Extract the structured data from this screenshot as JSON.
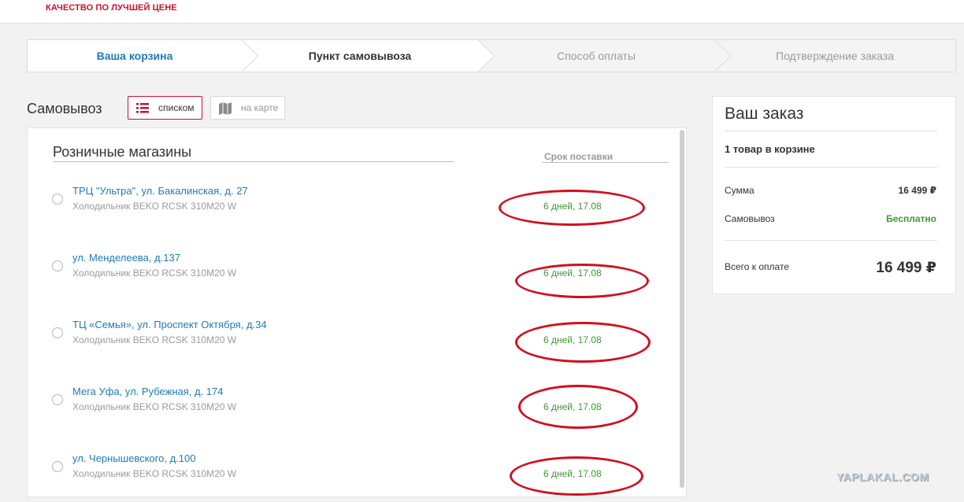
{
  "header": {
    "tagline": "КАЧЕСТВО ПО ЛУЧШЕЙ ЦЕНЕ"
  },
  "steps": [
    {
      "label": "Ваша корзина",
      "state": "completed"
    },
    {
      "label": "Пункт самовывоза",
      "state": "current"
    },
    {
      "label": "Способ оплаты",
      "state": "upcoming"
    },
    {
      "label": "Подтверждение заказа",
      "state": "upcoming"
    }
  ],
  "pickup": {
    "title": "Самовывоз",
    "view_list_label": "списком",
    "view_map_label": "на карте",
    "view_selected": "list"
  },
  "stores": {
    "section_title": "Розничные магазины",
    "delivery_header": "Срок поставки",
    "items": [
      {
        "name": "ТРЦ \"Ультра\", ул. Бакалинская, д. 27",
        "product": "Холодильник BEKO RCSK 310M20 W",
        "delivery": "6 дней, 17.08"
      },
      {
        "name": "ул. Менделеева, д.137",
        "product": "Холодильник BEKO RCSK 310M20 W",
        "delivery": "6 дней, 17.08"
      },
      {
        "name": "ТЦ «Семья», ул. Проспект Октября, д.34",
        "product": "Холодильник BEKO RCSK 310M20 W",
        "delivery": "6 дней, 17.08"
      },
      {
        "name": "Мега Уфа, ул. Рубежная, д. 174",
        "product": "Холодильник BEKO RCSK 310M20 W",
        "delivery": "6 дней, 17.08"
      },
      {
        "name": "ул. Чернышевского, д.100",
        "product": "Холодильник BEKO RCSK 310M20 W",
        "delivery": "6 дней, 17.08"
      }
    ]
  },
  "order": {
    "title": "Ваш заказ",
    "cart_count": "1 товар в корзине",
    "sum_label": "Сумма",
    "sum_value": "16 499 ₽",
    "pickup_label": "Самовывоз",
    "pickup_value": "Бесплатно",
    "total_label": "Всего к оплате",
    "total_value": "16 499 ₽"
  },
  "watermark": "YAPLAKAL.COM",
  "colors": {
    "brand_red": "#c8102e",
    "link_blue": "#1f7ab8",
    "green": "#3a9a2f",
    "annotation_red": "#d01020"
  }
}
